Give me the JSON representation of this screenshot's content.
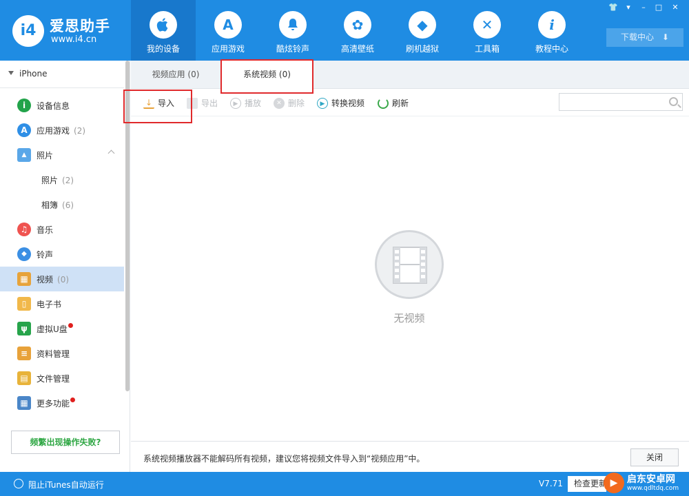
{
  "app": {
    "logo_glyph": "i4",
    "logo_title": "爱思助手",
    "logo_url": "www.i4.cn"
  },
  "nav": [
    {
      "label": "我的设备",
      "icon": "apple-icon",
      "glyph": "●"
    },
    {
      "label": "应用游戏",
      "icon": "app-store-icon",
      "glyph": "A"
    },
    {
      "label": "酷炫铃声",
      "icon": "bell-icon",
      "glyph": "♪"
    },
    {
      "label": "高清壁纸",
      "icon": "flower-icon",
      "glyph": "✿"
    },
    {
      "label": "刷机越狱",
      "icon": "dropbox-icon",
      "glyph": "◆"
    },
    {
      "label": "工具箱",
      "icon": "tools-icon",
      "glyph": "✕"
    },
    {
      "label": "教程中心",
      "icon": "info-icon",
      "glyph": "i"
    }
  ],
  "window_controls": [
    "👕",
    "▾",
    "–",
    "□",
    "✕"
  ],
  "download_center": {
    "label": "下载中心",
    "glyph": "⬇"
  },
  "sidebar": {
    "device": "iPhone",
    "items": [
      {
        "label": "设备信息",
        "count": "",
        "icon": "info-icon",
        "glyph": "i",
        "color": "#22a34a"
      },
      {
        "label": "应用游戏",
        "count": "(2)",
        "icon": "app-store-icon",
        "glyph": "A",
        "color": "#2f8fe6"
      },
      {
        "label": "照片",
        "count": "",
        "icon": "photo-icon",
        "glyph": "▲",
        "color": "#5aa7e8"
      },
      {
        "label": "照片",
        "count": "(2)"
      },
      {
        "label": "相簿",
        "count": "(6)"
      },
      {
        "label": "音乐",
        "count": "",
        "icon": "music-icon",
        "glyph": "♫",
        "color": "#ef5350"
      },
      {
        "label": "铃声",
        "count": "",
        "icon": "bell-icon",
        "glyph": "◆",
        "color": "#3b8fe4"
      },
      {
        "label": "视频",
        "count": "(0)",
        "icon": "video-icon",
        "glyph": "▦",
        "color": "#e7a33a"
      },
      {
        "label": "电子书",
        "count": "",
        "icon": "book-icon",
        "glyph": "▯",
        "color": "#f1b84a"
      },
      {
        "label": "虚拟U盘",
        "count": "",
        "icon": "usb-icon",
        "glyph": "ψ",
        "color": "#27a44b"
      },
      {
        "label": "资料管理",
        "count": "",
        "icon": "contacts-icon",
        "glyph": "≡",
        "color": "#e8a23a"
      },
      {
        "label": "文件管理",
        "count": "",
        "icon": "file-icon",
        "glyph": "▤",
        "color": "#e8b33a"
      },
      {
        "label": "更多功能",
        "count": "",
        "icon": "grid-icon",
        "glyph": "▦",
        "color": "#4a86c8"
      }
    ],
    "help_button": "频繁出现操作失败?"
  },
  "tabs": [
    {
      "label": "视频应用 (0)"
    },
    {
      "label": "系统视频 (0)"
    }
  ],
  "toolbar": {
    "import": "导入",
    "export": "导出",
    "play": "播放",
    "delete": "删除",
    "convert": "转换视频",
    "refresh": "刷新",
    "search_placeholder": ""
  },
  "empty_state": {
    "label": "无视频"
  },
  "info_bar": {
    "text": "系统视频播放器不能解码所有视频，建议您将视频文件导入到“视频应用”中。",
    "close": "关闭"
  },
  "status_bar": {
    "itunes_label": "阻止iTunes自动运行",
    "version": "V7.71",
    "update_button": "检查更新"
  },
  "watermark": {
    "title": "启东安卓网",
    "url": "www.qdltdq.com"
  },
  "colors": {
    "brand": "#1f8ce3",
    "highlight": "#e0292b",
    "active_row": "#cfe1f6"
  }
}
